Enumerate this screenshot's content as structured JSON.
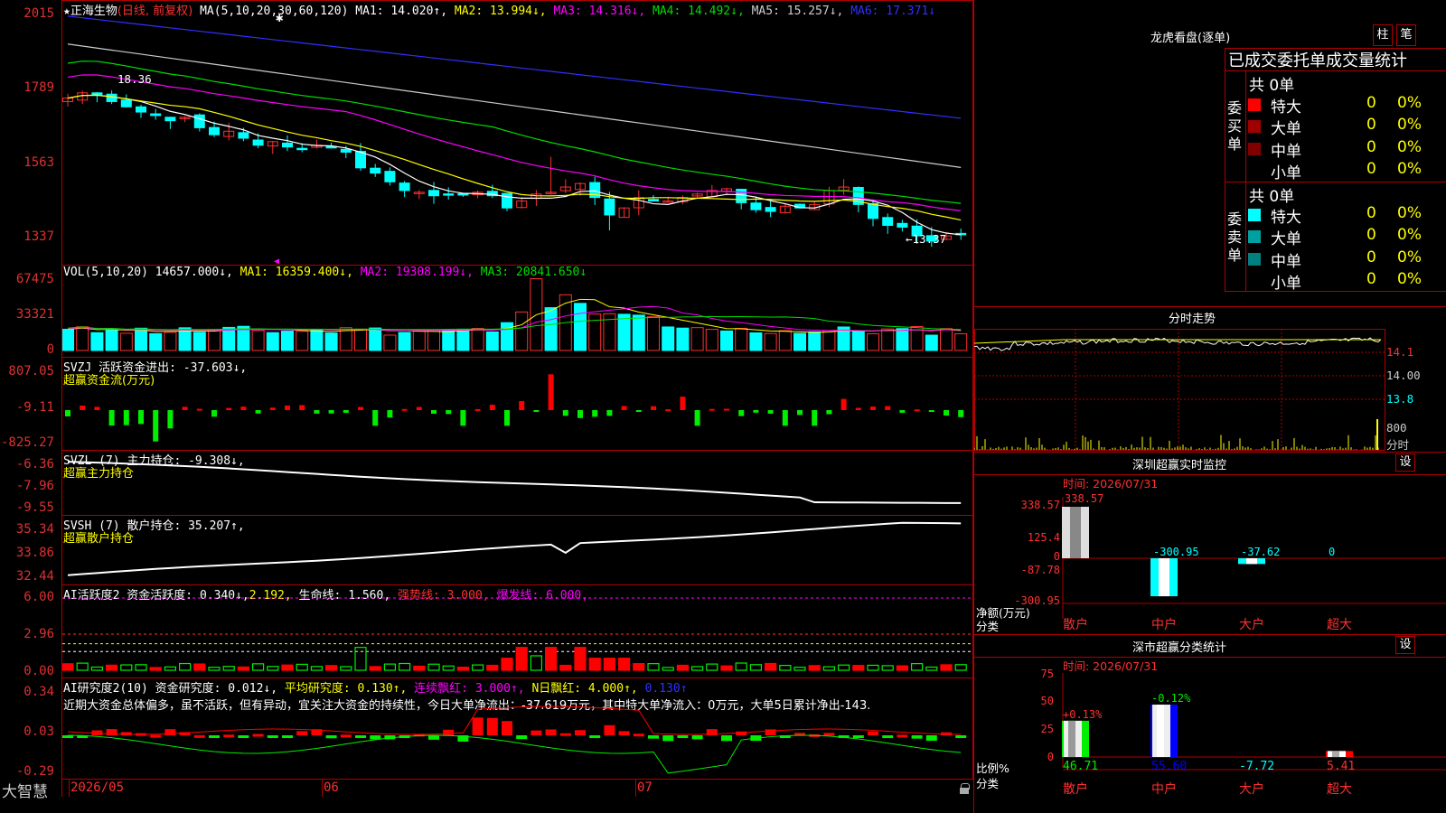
{
  "app": {
    "logo": "大智慧",
    "lock_icon": "lock-icon"
  },
  "colors": {
    "up": "#ff3030",
    "down": "#00ffff",
    "grid": "#b00000",
    "bg": "#000000",
    "ma1": "#ffffff",
    "ma2": "#ffff00",
    "ma3": "#ff00ff",
    "ma4": "#00dd00",
    "ma5": "#cccccc",
    "ma6": "#3030ff"
  },
  "kline": {
    "stock": "正海生物",
    "mode": "(日线, 前复权)",
    "ma_label": "MA(5,10,20,30,60,120)",
    "ma": [
      {
        "name": "MA1",
        "text": "MA1: 14.020↑,",
        "color": "#ffffff"
      },
      {
        "name": "MA2",
        "text": "MA2: 13.994↓,",
        "color": "#ffff00"
      },
      {
        "name": "MA3",
        "text": "MA3: 14.316↓,",
        "color": "#ff00ff"
      },
      {
        "name": "MA4",
        "text": "MA4: 14.492↓,",
        "color": "#00dd00"
      },
      {
        "name": "MA5",
        "text": "MA5: 15.257↓,",
        "color": "#cccccc"
      },
      {
        "name": "MA6",
        "text": "MA6: 17.371↓",
        "color": "#3030ff"
      }
    ],
    "y_labels": [
      "2015",
      "1789",
      "1563",
      "1337"
    ],
    "high_mark": "18.36",
    "low_mark": "←13.37"
  },
  "vol": {
    "label": "VOL(5,10,20)",
    "value": "14657.000↓,",
    "ma1": "MA1: 16359.400↓,",
    "ma2": "MA2: 19308.199↓,",
    "ma3": "MA3: 20841.650↓",
    "y_labels": [
      "67475",
      "33321",
      "0"
    ]
  },
  "svzj": {
    "label": "SVZJ  活跃资金进出: -37.603↓,",
    "sub": "超赢资金流(万元)",
    "y_labels": [
      "807.05",
      "-9.11",
      "-825.27"
    ]
  },
  "svzl": {
    "label": "SVZL (7) 主力持仓: -9.308↓,",
    "sub": "超赢主力持仓",
    "y_labels": [
      "-6.36",
      "-7.96",
      "-9.55"
    ]
  },
  "svsh": {
    "label": "SVSH (7) 散户持仓: 35.207↑,",
    "sub": "超赢散户持仓",
    "y_labels": [
      "35.34",
      "33.86",
      "32.44"
    ]
  },
  "ai1": {
    "label": "AI活跃度2 资金活跃度: 0.340↓,",
    "v2": "2.192,",
    "v3": "生命线: 1.560,",
    "v4": "强势线: 3.000,",
    "v5": "爆发线: 6.000,",
    "y_labels": [
      "6.00",
      "2.96",
      "0.00"
    ]
  },
  "ai2": {
    "label": "AI研究度2(10) 资金研究度: 0.012↓,",
    "v2": "平均研究度: 0.130↑,",
    "v3": "连续飘红: 3.000↑,",
    "v4": "N日飘红: 4.000↑,",
    "v5": "0.130↑",
    "comment": "近期大资金总体偏多，虽不活跃，但有异动，宜关注大资金的持续性，今日大单净流出：-37.619万元，其中特大单净流入：0万元，大单5日累计净出-143.",
    "y_labels": [
      "0.34",
      "0.03",
      "-0.29"
    ]
  },
  "xaxis": {
    "labels": [
      "2026/05",
      "06",
      "07"
    ]
  },
  "right": {
    "dragon_title": "龙虎看盘(逐单)",
    "btn_zhu": "柱",
    "btn_bi": "笔",
    "tabs": "已成交委托单成交量统计",
    "buy_side": "委买单",
    "sell_side": "委卖单",
    "buy_total": "共 0单",
    "sell_total": "共 0单",
    "buy_rows": [
      {
        "label": "特大",
        "count": "0",
        "pct": "0%",
        "color": "#ff0000"
      },
      {
        "label": "大单",
        "count": "0",
        "pct": "0%",
        "color": "#a00000"
      },
      {
        "label": "中单",
        "count": "0",
        "pct": "0%",
        "color": "#800000"
      },
      {
        "label": "小单",
        "count": "0",
        "pct": "0%",
        "color": ""
      }
    ],
    "sell_rows": [
      {
        "label": "特大",
        "count": "0",
        "pct": "0%",
        "color": "#00ffff"
      },
      {
        "label": "大单",
        "count": "0",
        "pct": "0%",
        "color": "#00a0a0"
      },
      {
        "label": "中单",
        "count": "0",
        "pct": "0%",
        "color": "#008080"
      },
      {
        "label": "小单",
        "count": "0",
        "pct": "0%",
        "color": ""
      }
    ],
    "intraday_title": "分时走势",
    "intraday_y": [
      "14.1",
      "14.00",
      "13.8"
    ],
    "intraday_vol": "800",
    "intraday_vol_unit": "分时",
    "monitor_title": "深圳超赢实时监控",
    "monitor_btn": "设",
    "monitor_time": "时间: 2026/07/31",
    "monitor_y": [
      "338.57",
      "125.4",
      "0",
      "-87.78",
      "-300.95"
    ],
    "monitor_axis_title": "净额(万元)",
    "monitor_axis_sub": "分类",
    "monitor_cats": [
      "散户",
      "中户",
      "大户",
      "超大"
    ],
    "monitor_values": [
      338.57,
      -300.95,
      -37.62,
      0
    ],
    "monitor_value_labels": [
      "338.57",
      "-300.95",
      "-37.62",
      "0"
    ],
    "classify_title": "深市超赢分类统计",
    "classify_btn": "设",
    "classify_time": "时间: 2026/07/31",
    "classify_y": [
      "75",
      "50",
      "25",
      "0"
    ],
    "classify_axis_title": "比例%",
    "classify_axis_sub": "分类",
    "classify_cats": [
      "散户",
      "中户",
      "大户",
      "超大"
    ],
    "classify_top": [
      "+0.13%",
      "-0.12%",
      "",
      ""
    ],
    "classify_values": [
      46.71,
      55.6,
      -7.72,
      5.41
    ],
    "classify_value_labels": [
      "46.71",
      "55.60",
      "-7.72",
      "5.41"
    ]
  }
}
